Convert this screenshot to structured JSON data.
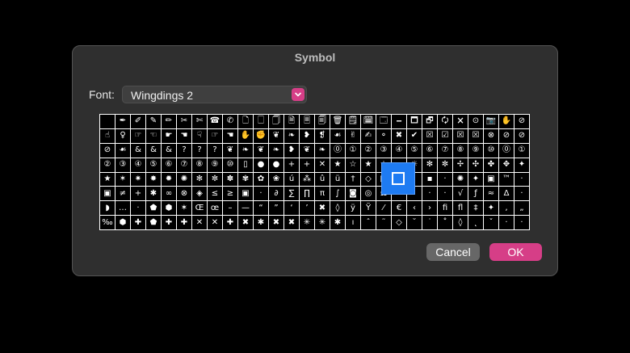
{
  "dialog": {
    "title": "Symbol",
    "font_label": "Font:",
    "font_value": "Wingdings 2",
    "selected_symbol_icon": "square-outline-icon",
    "buttons": {
      "cancel": "Cancel",
      "ok": "OK"
    },
    "colors": {
      "accent": "#d63e87",
      "selection": "#1e7bf2",
      "dialog_bg": "#2f2f2f"
    }
  },
  "symbols": [
    " ",
    "✒",
    "✐",
    "✎",
    "✏",
    "✂",
    "✄",
    "☎",
    "✆",
    "🗋",
    "🗌",
    "🗍",
    "🗎",
    "🗏",
    "🗐",
    "🗑",
    "🗒",
    "🗓",
    "🗔",
    "🗕",
    "🗖",
    "🗗",
    "🗘",
    "🗙",
    "⊙",
    "📷",
    "✋",
    "⊘",
    "☝",
    "♀",
    "☞",
    "☜",
    "☛",
    "☚",
    "☟",
    "☞",
    "☚",
    "✋",
    "✊",
    "❦",
    "❧",
    "❥",
    "❡",
    "☙",
    "✌",
    "✍",
    "⚬",
    "✖",
    "✔",
    "☒",
    "☑",
    "☒",
    "☒",
    "⊗",
    "⊘",
    "⊘",
    "⊘",
    "☙",
    "&",
    "&",
    "&",
    "?",
    "?",
    "?",
    "❦",
    "❧",
    "❦",
    "❧",
    "❥",
    "❦",
    "❧",
    "⓪",
    "①",
    "②",
    "③",
    "④",
    "⑤",
    "⑥",
    "⑦",
    "⑧",
    "⑨",
    "⑩",
    "⓪",
    "①",
    "②",
    "③",
    "④",
    "⑤",
    "⑥",
    "⑦",
    "⑧",
    "⑨",
    "⑩",
    "▯",
    "●",
    "●",
    "+",
    "+",
    "✕",
    "★",
    "☆",
    "★",
    "☆",
    "·",
    "☼",
    "✻",
    "✼",
    "✢",
    "✣",
    "✤",
    "✥",
    "✦",
    "★",
    "✶",
    "✷",
    "✸",
    "✹",
    "✺",
    "✻",
    "✼",
    "✽",
    "✾",
    "✿",
    "❀",
    "ú",
    "⁂",
    "û",
    "ü",
    "†",
    "◇",
    "□",
    "◈",
    "·",
    "▪",
    "·",
    "✺",
    "✦",
    "▣",
    "™",
    "·",
    "▣",
    "≠",
    "+",
    "✱",
    "∞",
    "⊗",
    "◈",
    "≤",
    "≥",
    "▣",
    "·",
    "∂",
    "∑",
    "∏",
    "π",
    "∫",
    "◙",
    "◎",
    "Ω",
    "·",
    "·",
    "·",
    "·",
    "√",
    "ƒ",
    "≈",
    "Δ",
    "·",
    "◗",
    "…",
    "·",
    "⬟",
    "⬢",
    "✶",
    "Œ",
    "œ",
    "–",
    "—",
    "“",
    "”",
    "‘",
    "’",
    "✖",
    "◊",
    "ÿ",
    "Ÿ",
    "⁄",
    "€",
    "‹",
    "›",
    "ﬁ",
    "ﬂ",
    "‡",
    "✦",
    "‚",
    "„",
    "‰",
    "⬢",
    "✚",
    "⬟",
    "✚",
    "✚",
    "✕",
    "✕",
    "✚",
    "✖",
    "✱",
    "✖",
    "✖",
    "✳",
    "✳",
    "✱",
    "ı",
    "ˆ",
    "˜",
    "◇",
    "˘",
    "˙",
    "˚",
    "◊",
    "˛",
    "ˇ",
    "·",
    "·"
  ]
}
